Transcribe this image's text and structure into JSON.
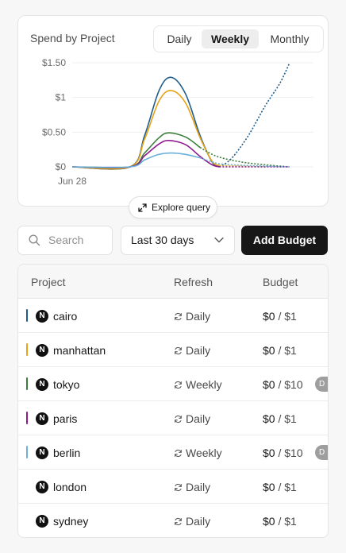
{
  "chart": {
    "title": "Spend by Project",
    "tabs": [
      "Daily",
      "Weekly",
      "Monthly"
    ],
    "active_tab": "Weekly",
    "explore_label": "Explore query"
  },
  "chart_data": {
    "type": "line",
    "ylim": [
      0,
      1.5
    ],
    "ytick_labels": [
      "$1.50",
      "$1",
      "$0.50",
      "$0"
    ],
    "yticks": [
      1.5,
      1,
      0.5,
      0
    ],
    "xtick_label": "Jun 28",
    "grid": true,
    "x_range": [
      0,
      1
    ],
    "series": [
      {
        "color": "#1f5d8c",
        "values": [
          [
            0,
            0
          ],
          [
            0.24,
            0
          ],
          [
            0.3,
            0.45
          ],
          [
            0.36,
            1.1
          ],
          [
            0.41,
            1.29
          ],
          [
            0.47,
            1.05
          ],
          [
            0.53,
            0.45
          ],
          [
            0.58,
            0.07
          ],
          [
            0.61,
            0
          ],
          [
            0.66,
            0.12
          ],
          [
            0.73,
            0.45
          ],
          [
            0.8,
            0.88
          ],
          [
            0.86,
            1.2
          ],
          [
            0.9,
            1.49
          ]
        ],
        "projected_from": 0.61
      },
      {
        "color": "#e8a317",
        "values": [
          [
            0,
            0
          ],
          [
            0.24,
            0
          ],
          [
            0.3,
            0.4
          ],
          [
            0.36,
            0.95
          ],
          [
            0.41,
            1.1
          ],
          [
            0.47,
            0.92
          ],
          [
            0.53,
            0.42
          ],
          [
            0.58,
            0.08
          ],
          [
            0.61,
            0.02
          ],
          [
            0.7,
            0.01
          ],
          [
            0.8,
            0
          ]
        ],
        "projected_from": 0.61
      },
      {
        "color": "#3b7d3b",
        "values": [
          [
            0,
            0
          ],
          [
            0.24,
            0
          ],
          [
            0.3,
            0.2
          ],
          [
            0.36,
            0.42
          ],
          [
            0.4,
            0.49
          ],
          [
            0.47,
            0.43
          ],
          [
            0.53,
            0.28
          ],
          [
            0.58,
            0.18
          ],
          [
            0.63,
            0.12
          ],
          [
            0.72,
            0.06
          ],
          [
            0.83,
            0.02
          ],
          [
            0.9,
            0
          ]
        ],
        "projected_from": 0.53
      },
      {
        "color": "#8e1a8e",
        "values": [
          [
            0,
            0
          ],
          [
            0.24,
            0
          ],
          [
            0.3,
            0.16
          ],
          [
            0.36,
            0.33
          ],
          [
            0.4,
            0.38
          ],
          [
            0.47,
            0.32
          ],
          [
            0.53,
            0.15
          ],
          [
            0.58,
            0.03
          ],
          [
            0.61,
            0
          ],
          [
            0.9,
            0
          ]
        ],
        "projected_from": 0.61
      },
      {
        "color": "#6ab0d8",
        "values": [
          [
            0,
            0
          ],
          [
            0.24,
            0
          ],
          [
            0.3,
            0.1
          ],
          [
            0.36,
            0.18
          ],
          [
            0.41,
            0.2
          ],
          [
            0.47,
            0.18
          ],
          [
            0.53,
            0.13
          ],
          [
            0.58,
            0.07
          ],
          [
            0.62,
            0.04
          ],
          [
            0.72,
            0.02
          ],
          [
            0.9,
            0
          ]
        ],
        "projected_from": 0.53
      }
    ]
  },
  "search": {
    "placeholder": "Search"
  },
  "range": {
    "label": "Last 30 days"
  },
  "add_button": {
    "label": "Add Budget"
  },
  "table": {
    "headers": {
      "project": "Project",
      "refresh": "Refresh",
      "budget": "Budget"
    },
    "rows": [
      {
        "name": "cairo",
        "avatar": "N",
        "color": "#1f5d8c",
        "refresh": "Daily",
        "spent": "$0",
        "limit": "/ $1",
        "pill": ""
      },
      {
        "name": "manhattan",
        "avatar": "N",
        "color": "#e8a317",
        "refresh": "Daily",
        "spent": "$0",
        "limit": "/ $1",
        "pill": ""
      },
      {
        "name": "tokyo",
        "avatar": "N",
        "color": "#3b7d3b",
        "refresh": "Weekly",
        "spent": "$0",
        "limit": "/ $10",
        "pill": "D"
      },
      {
        "name": "paris",
        "avatar": "N",
        "color": "#8e1a8e",
        "refresh": "Daily",
        "spent": "$0",
        "limit": "/ $1",
        "pill": ""
      },
      {
        "name": "berlin",
        "avatar": "N",
        "color": "#6ab0d8",
        "refresh": "Weekly",
        "spent": "$0",
        "limit": "/ $10",
        "pill": "D"
      },
      {
        "name": "london",
        "avatar": "N",
        "color": "",
        "refresh": "Daily",
        "spent": "$0",
        "limit": "/ $1",
        "pill": ""
      },
      {
        "name": "sydney",
        "avatar": "N",
        "color": "",
        "refresh": "Daily",
        "spent": "$0",
        "limit": "/ $1",
        "pill": ""
      }
    ]
  }
}
